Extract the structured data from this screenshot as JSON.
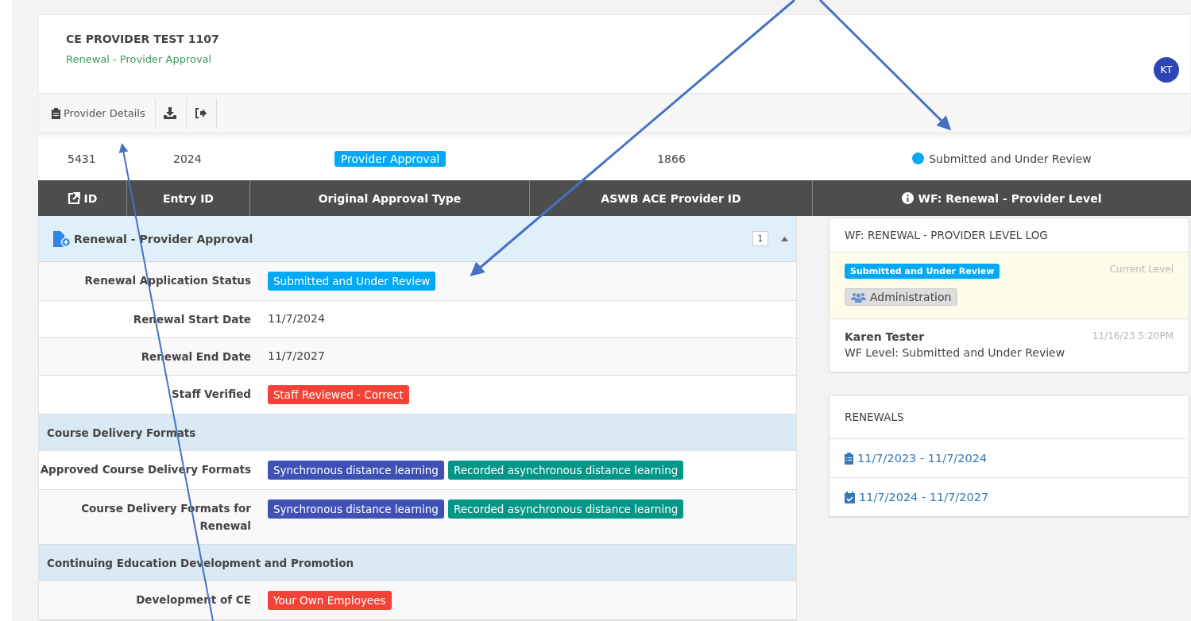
{
  "header": {
    "title": "CE PROVIDER TEST 1107",
    "subtitle": "Renewal - Provider Approval",
    "avatar": "KT"
  },
  "toolbar": [
    {
      "kind": "details",
      "label": "Provider Details"
    },
    {
      "kind": "download"
    },
    {
      "kind": "exit"
    }
  ],
  "summary": [
    {
      "kind": "text",
      "text": "5431"
    },
    {
      "kind": "text",
      "text": "2024"
    },
    {
      "kind": "badge",
      "text": "Provider Approval",
      "color": "#03a9f4"
    },
    {
      "kind": "text",
      "text": "1866"
    },
    {
      "kind": "status",
      "text": "Submitted and Under Review",
      "color": "#03a9f4"
    }
  ],
  "columns": [
    {
      "kind": "link",
      "label": "ID"
    },
    {
      "kind": "plain",
      "label": "Entry ID"
    },
    {
      "kind": "plain",
      "label": "Original Approval Type"
    },
    {
      "kind": "plain",
      "label": "ASWB ACE Provider ID"
    },
    {
      "kind": "info",
      "label": "WF: Renewal - Provider Level"
    }
  ],
  "section": {
    "title": "Renewal - Provider Approval",
    "count": "1",
    "expanded": true,
    "rows": [
      {
        "kind": "field",
        "label": "Renewal Application Status",
        "badges": [
          {
            "text": "Submitted and Under Review",
            "color": "#03a9f4"
          }
        ]
      },
      {
        "kind": "field",
        "label": "Renewal Start Date",
        "value": "11/7/2024"
      },
      {
        "kind": "field",
        "label": "Renewal End Date",
        "value": "11/7/2027"
      },
      {
        "kind": "field",
        "label": "Staff Verified",
        "badges": [
          {
            "text": "Staff Reviewed - Correct",
            "color": "#f44336"
          }
        ]
      },
      {
        "kind": "group",
        "title": "Course Delivery Formats"
      },
      {
        "kind": "field",
        "label": "Approved Course Delivery Formats",
        "badges": [
          {
            "text": "Synchronous distance learning",
            "color": "#3f51b5"
          },
          {
            "text": "Recorded asynchronous distance learning",
            "color": "#009688"
          }
        ]
      },
      {
        "kind": "field",
        "label": "Course Delivery Formats for Renewal",
        "badges": [
          {
            "text": "Synchronous distance learning",
            "color": "#3f51b5"
          },
          {
            "text": "Recorded asynchronous distance learning",
            "color": "#009688"
          }
        ]
      },
      {
        "kind": "group",
        "title": "Continuing Education Development and Promotion"
      },
      {
        "kind": "field",
        "label": "Development of CE",
        "badges": [
          {
            "text": "Your Own Employees",
            "color": "#f44336"
          }
        ]
      }
    ]
  },
  "log": {
    "title": "WF: RENEWAL - PROVIDER LEVEL LOG",
    "entries": [
      {
        "kind": "current",
        "status": "Submitted and Under Review",
        "team": "Administration",
        "note": "Current Level"
      },
      {
        "kind": "event",
        "name": "Karen Tester",
        "time": "11/16/23 5:20PM",
        "text": "WF Level: Submitted and Under Review"
      }
    ]
  },
  "renewals": {
    "title": "RENEWALS",
    "items": [
      {
        "kind": "past",
        "label": "11/7/2023 - 11/7/2024"
      },
      {
        "kind": "current",
        "label": "11/7/2024 - 11/7/2027"
      }
    ]
  }
}
